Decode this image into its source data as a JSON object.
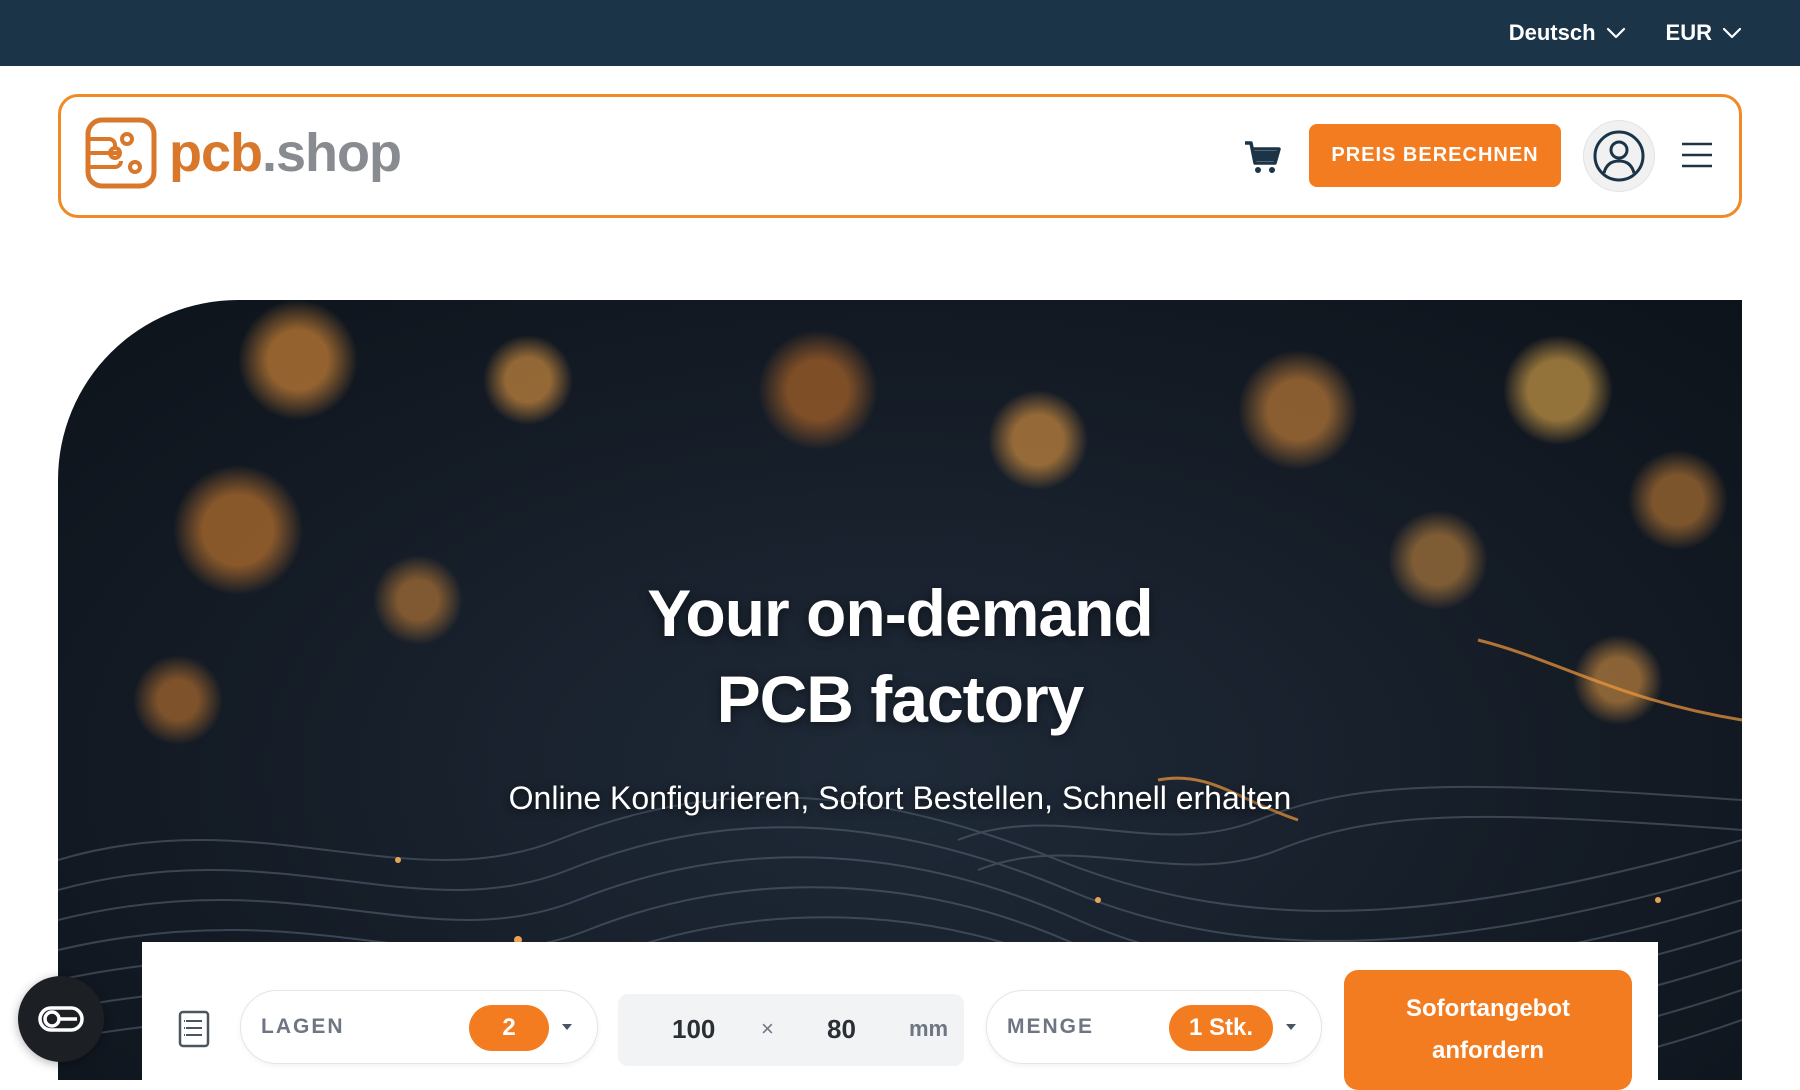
{
  "topbar": {
    "language": "Deutsch",
    "currency": "EUR"
  },
  "header": {
    "logo_prefix": "pcb",
    "logo_suffix": ".shop",
    "cta_label": "PREIS BERECHNEN",
    "icons": [
      "cart-icon",
      "user-icon",
      "menu-icon"
    ]
  },
  "hero": {
    "title_line1": "Your on-demand",
    "title_line2": "PCB factory",
    "subtitle": "Online Konfigurieren, Sofort Bestellen, Schnell erhalten"
  },
  "configurator": {
    "layers_label": "LAGEN",
    "layers_value": "2",
    "width": "100",
    "times": "×",
    "height": "80",
    "unit": "mm",
    "quantity_label": "MENGE",
    "quantity_value": "1 Stk.",
    "quote_line1": "Sofortangebot",
    "quote_line2": "anfordern"
  },
  "colors": {
    "accent": "#f47c20",
    "topbar": "#1b3447",
    "logo_orange": "#d9782a",
    "logo_gray": "#888c90"
  }
}
